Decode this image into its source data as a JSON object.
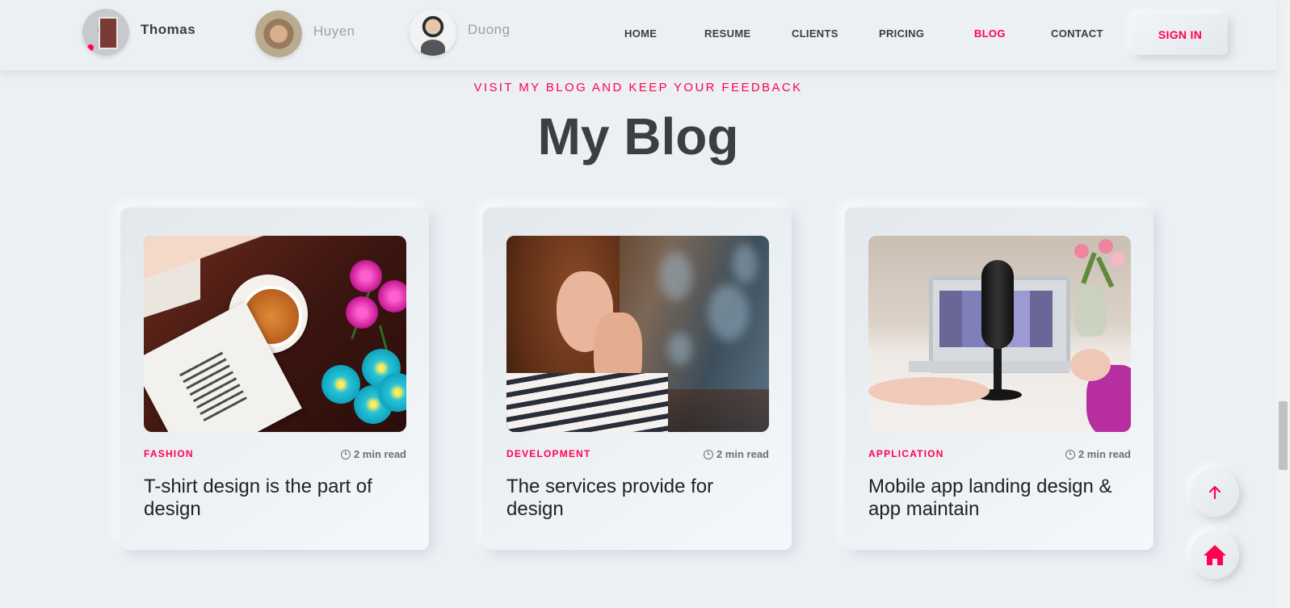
{
  "header": {
    "users": [
      {
        "name": "Thomas",
        "state": "active"
      },
      {
        "name": "Huyen",
        "state": "inactive"
      },
      {
        "name": "Duong",
        "state": "inactive"
      }
    ],
    "nav": [
      {
        "label": "HOME",
        "active": false
      },
      {
        "label": "RESUME",
        "active": false
      },
      {
        "label": "CLIENTS",
        "active": false
      },
      {
        "label": "PRICING",
        "active": false
      },
      {
        "label": "BLOG",
        "active": true
      },
      {
        "label": "CONTACT",
        "active": false
      }
    ],
    "signin_label": "SIGN IN"
  },
  "section": {
    "subtitle": "VISIT MY BLOG AND KEEP YOUR FEEDBACK",
    "title": "My Blog"
  },
  "posts": [
    {
      "category": "FASHION",
      "read_time": "2 min read",
      "title": "T-shirt design is the part of design",
      "image": "tea-book-flowers-photo"
    },
    {
      "category": "DEVELOPMENT",
      "read_time": "2 min read",
      "title": "The services provide for design",
      "image": "praying-woman-photo"
    },
    {
      "category": "APPLICATION",
      "read_time": "2 min read",
      "title": "Mobile app landing design & app maintain",
      "image": "podcast-microphone-photo"
    }
  ],
  "floating": {
    "scroll_top_icon": "arrow-up-icon",
    "home_icon": "home-icon"
  },
  "colors": {
    "accent": "#ff014f",
    "background": "#ecf0f3",
    "text": "#3c3e41"
  }
}
